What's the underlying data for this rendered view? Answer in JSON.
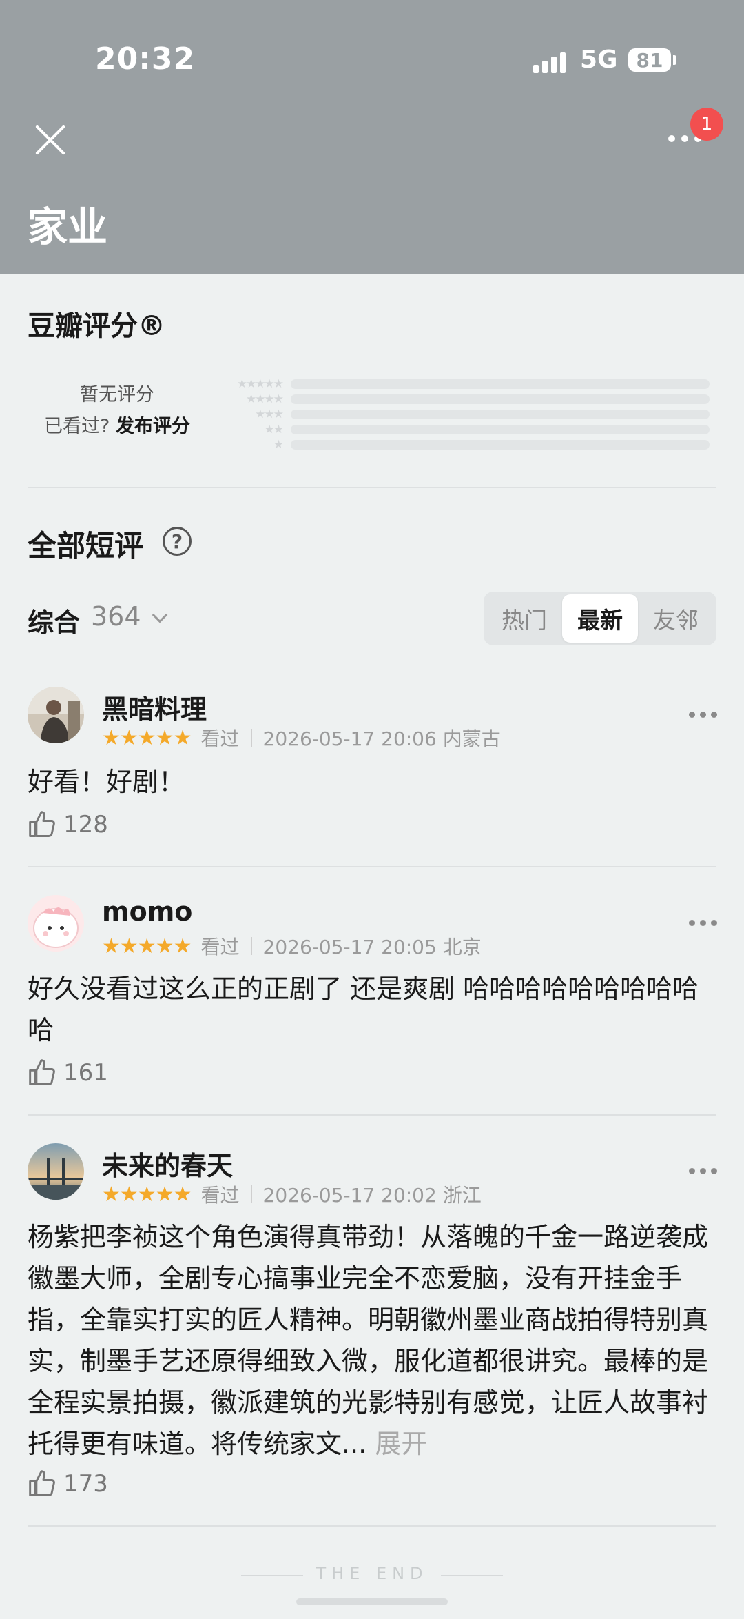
{
  "status_bar": {
    "time": "20:32",
    "network": "5G",
    "battery": "81"
  },
  "nav": {
    "title": "家业",
    "badge_count": "1"
  },
  "rating": {
    "title": "豆瓣评分®",
    "no_rating": "暂无评分",
    "seen_prompt": "已看过?",
    "publish": "发布评分",
    "star_rows": [
      "★★★★★",
      "★★★★",
      "★★★",
      "★★",
      "★"
    ]
  },
  "comments": {
    "title": "全部短评",
    "help_icon": "?",
    "sort_label": "综合",
    "count": "364",
    "tabs": [
      {
        "label": "热门",
        "active": false
      },
      {
        "label": "最新",
        "active": true
      },
      {
        "label": "友邻",
        "active": false
      }
    ],
    "items": [
      {
        "name": "黑暗料理",
        "stars": "★★★★★",
        "status": "看过",
        "time": "2026-05-17 20:06 内蒙古",
        "text": "好看！好剧！",
        "likes": "128"
      },
      {
        "name": "momo",
        "stars": "★★★★★",
        "status": "看过",
        "time": "2026-05-17 20:05 北京",
        "text": "好久没看过这么正的正剧了 还是爽剧 哈哈哈哈哈哈哈哈哈哈",
        "likes": "161"
      },
      {
        "name": "未来的春天",
        "stars": "★★★★★",
        "status": "看过",
        "time": "2026-05-17 20:02 浙江",
        "text": "杨紫把李祯这个角色演得真带劲！从落魄的千金一路逆袭成徽墨大师，全剧专心搞事业完全不恋爱脑，没有开挂金手指，全靠实打实的匠人精神。明朝徽州墨业商战拍得特别真实，制墨手艺还原得细致入微，服化道都很讲究。最棒的是全程实景拍摄，徽派建筑的光影特别有感觉，让匠人故事衬托得更有味道。将传统家文...",
        "expand": "展开",
        "likes": "173"
      }
    ]
  },
  "footer": {
    "the_end": "THE END"
  },
  "colors": {
    "header_bg": "#9aa0a3",
    "star": "#f4a92a",
    "badge": "#f24f4f",
    "page_bg": "#eef1f1"
  }
}
